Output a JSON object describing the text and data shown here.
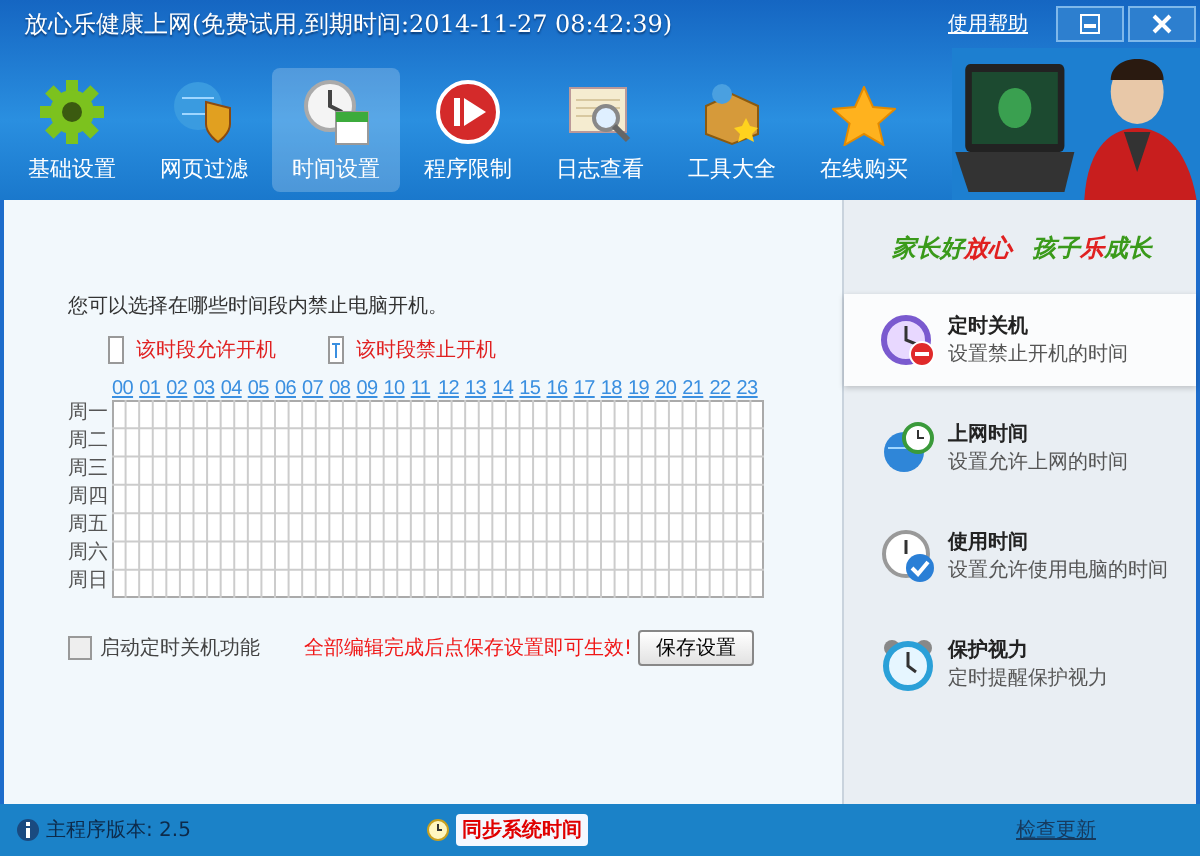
{
  "window": {
    "title": "放心乐健康上网(免费试用,到期时间:2014-11-27 08:42:39)",
    "help_link": "使用帮助"
  },
  "toolbar": [
    {
      "label": "基础设置",
      "selected": false
    },
    {
      "label": "网页过滤",
      "selected": false
    },
    {
      "label": "时间设置",
      "selected": true
    },
    {
      "label": "程序限制",
      "selected": false
    },
    {
      "label": "日志查看",
      "selected": false
    },
    {
      "label": "工具大全",
      "selected": false
    },
    {
      "label": "在线购买",
      "selected": false
    }
  ],
  "main": {
    "intro": "您可以选择在哪些时间段内禁止电脑开机。",
    "legend": [
      {
        "kind": "allowed",
        "label": "该时段允许开机"
      },
      {
        "kind": "forbidden",
        "label": "该时段禁止开机"
      }
    ],
    "hours": [
      "00",
      "01",
      "02",
      "03",
      "04",
      "05",
      "06",
      "07",
      "08",
      "09",
      "10",
      "11",
      "12",
      "13",
      "14",
      "15",
      "16",
      "17",
      "18",
      "19",
      "20",
      "21",
      "22",
      "23"
    ],
    "days": [
      "周一",
      "周二",
      "周三",
      "周四",
      "周五",
      "周六",
      "周日"
    ],
    "shutdown_checkbox": {
      "label": "启动定时关机功能",
      "checked": false
    },
    "notice": "全部编辑完成后点保存设置即可生效!",
    "save_button": "保存设置"
  },
  "sidebar": {
    "slogan_1": {
      "green": "家长好",
      "red": "放心"
    },
    "slogan_2": {
      "green": "孩子",
      "red": "乐",
      "green2": "成长"
    },
    "items": [
      {
        "title": "定时关机",
        "subtitle": "设置禁止开机的时间",
        "selected": true
      },
      {
        "title": "上网时间",
        "subtitle": "设置允许上网的时间",
        "selected": false
      },
      {
        "title": "使用时间",
        "subtitle": "设置允许使用电脑的时间",
        "selected": false
      },
      {
        "title": "保护视力",
        "subtitle": "定时提醒保护视力",
        "selected": false
      }
    ]
  },
  "status_bar": {
    "version": "主程序版本: 2.5",
    "sync_link": "同步系统时间",
    "update_link": "检查更新"
  }
}
